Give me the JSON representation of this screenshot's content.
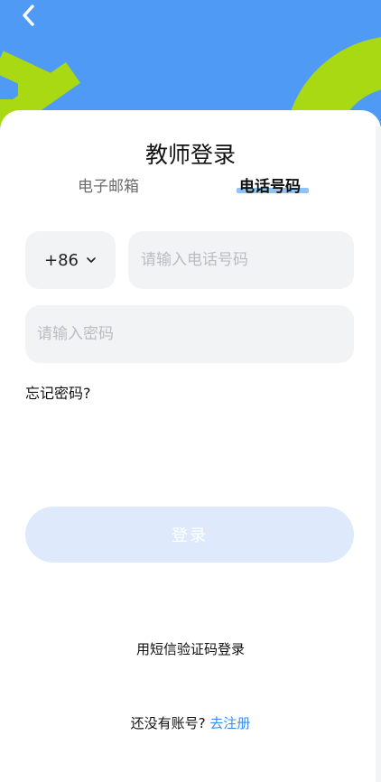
{
  "title": "教师登录",
  "tabs": {
    "email": "电子邮箱",
    "phone": "电话号码",
    "active": "phone"
  },
  "phone": {
    "country_code": "+86",
    "placeholder": "请输入电话号码"
  },
  "password": {
    "placeholder": "请输入密码"
  },
  "forgot_password": "忘记密码?",
  "login_button": "登录",
  "sms_login": "用短信验证码登录",
  "register": {
    "prompt": "还没有账号?",
    "link": "去注册"
  },
  "colors": {
    "hero_blue": "#4f9af4",
    "accent_lime": "#a8d912",
    "link_blue": "#3b8cee",
    "tab_highlight": "#8fc2f5",
    "login_disabled": "#deeafb"
  },
  "icons": {
    "back": "chevron-left-icon",
    "dropdown": "chevron-down-icon"
  }
}
